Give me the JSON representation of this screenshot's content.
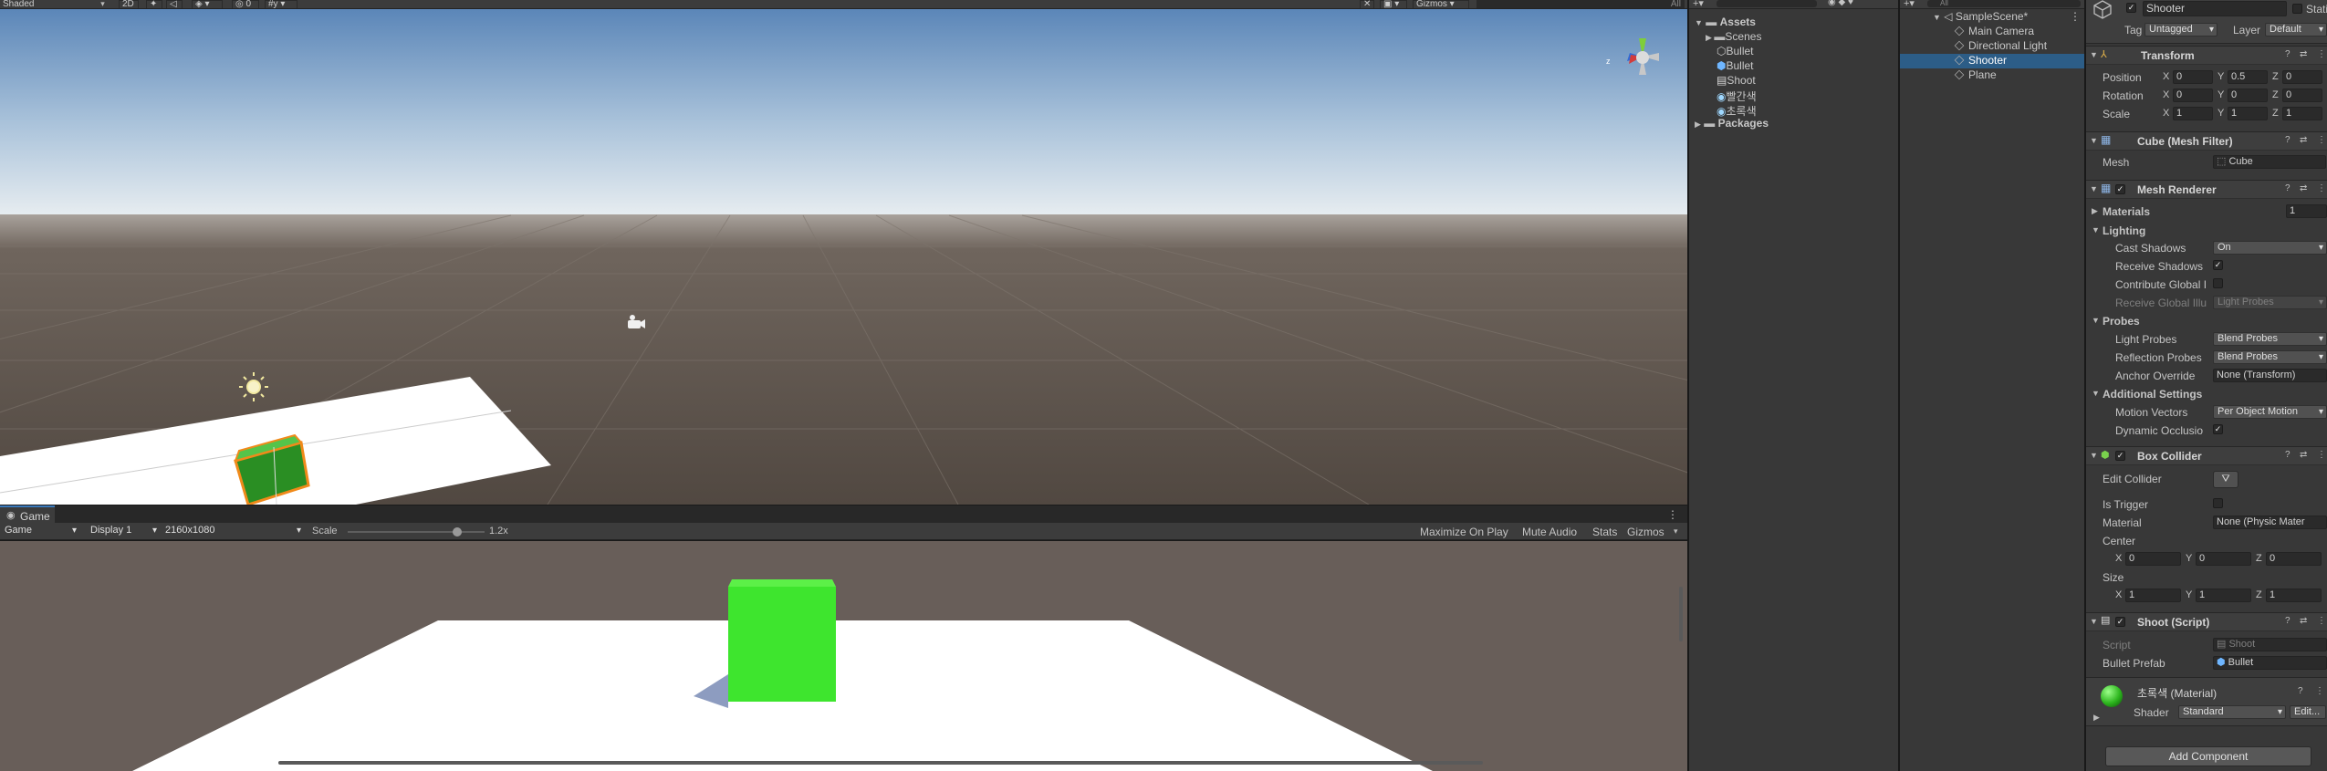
{
  "scene_toolbar": {
    "shading": "Shaded",
    "mode_2d": "2D",
    "gizmos": "Gizmos",
    "search_all": "All"
  },
  "game_view": {
    "tab_label": "Game",
    "view_dropdown": "Game",
    "display_dropdown": "Display 1",
    "resolution_dropdown": "2160x1080",
    "scale_label": "Scale",
    "scale_value": "1.2x",
    "scale_fraction": 0.8,
    "maximize_on_play": "Maximize On Play",
    "mute_audio": "Mute Audio",
    "stats": "Stats",
    "gizmos": "Gizmos"
  },
  "project": {
    "root": "Assets",
    "items": [
      {
        "label": "Scenes",
        "icon": "folder-icon"
      },
      {
        "label": "Bullet",
        "icon": "prefab-icon"
      },
      {
        "label": "Bullet",
        "icon": "prefab-blue-icon"
      },
      {
        "label": "Shoot",
        "icon": "script-icon"
      },
      {
        "label": "빨간색",
        "icon": "material-icon"
      },
      {
        "label": "초록색",
        "icon": "material-icon"
      }
    ],
    "packages": "Packages"
  },
  "hierarchy": {
    "search_placeholder": "All",
    "scene": "SampleScene*",
    "items": [
      {
        "label": "Main Camera",
        "selected": false
      },
      {
        "label": "Directional Light",
        "selected": false
      },
      {
        "label": "Shooter",
        "selected": true
      },
      {
        "label": "Plane",
        "selected": false
      }
    ]
  },
  "inspector": {
    "object_name": "Shooter",
    "static_label": "Static",
    "tag_label": "Tag",
    "tag_value": "Untagged",
    "layer_label": "Layer",
    "layer_value": "Default",
    "transform": {
      "title": "Transform",
      "position_label": "Position",
      "rotation_label": "Rotation",
      "scale_label": "Scale",
      "position": {
        "x": "0",
        "y": "0.5",
        "z": "0"
      },
      "rotation": {
        "x": "0",
        "y": "0",
        "z": "0"
      },
      "scale": {
        "x": "1",
        "y": "1",
        "z": "1"
      }
    },
    "mesh_filter": {
      "title": "Cube (Mesh Filter)",
      "mesh_label": "Mesh",
      "mesh_value": "Cube"
    },
    "mesh_renderer": {
      "title": "Mesh Renderer",
      "materials_label": "Materials",
      "materials_count": "1",
      "lighting_label": "Lighting",
      "cast_shadows_label": "Cast Shadows",
      "cast_shadows_value": "On",
      "receive_shadows_label": "Receive Shadows",
      "contribute_gi_label": "Contribute Global I",
      "receive_gi_label": "Receive Global Illu",
      "receive_gi_value": "Light Probes",
      "probes_label": "Probes",
      "light_probes_label": "Light Probes",
      "light_probes_value": "Blend Probes",
      "reflection_probes_label": "Reflection Probes",
      "reflection_probes_value": "Blend Probes",
      "anchor_override_label": "Anchor Override",
      "anchor_override_value": "None (Transform)",
      "additional_label": "Additional Settings",
      "motion_vectors_label": "Motion Vectors",
      "motion_vectors_value": "Per Object Motion",
      "dynamic_occlusion_label": "Dynamic Occlusio"
    },
    "box_collider": {
      "title": "Box Collider",
      "edit_collider_label": "Edit Collider",
      "is_trigger_label": "Is Trigger",
      "material_label": "Material",
      "material_value": "None (Physic Mater",
      "center_label": "Center",
      "center": {
        "x": "0",
        "y": "0",
        "z": "0"
      },
      "size_label": "Size",
      "size": {
        "x": "1",
        "y": "1",
        "z": "1"
      }
    },
    "shoot_script": {
      "title": "Shoot (Script)",
      "script_label": "Script",
      "script_value": "Shoot",
      "bullet_prefab_label": "Bullet Prefab",
      "bullet_prefab_value": "Bullet"
    },
    "material": {
      "title": "초록색 (Material)",
      "shader_label": "Shader",
      "shader_value": "Standard",
      "edit_label": "Edit..."
    },
    "add_component": "Add Component"
  },
  "colors": {
    "accent_select": "#2c5d87",
    "cube_green": "#3ee52e",
    "selection_orange": "#f08a1a"
  }
}
